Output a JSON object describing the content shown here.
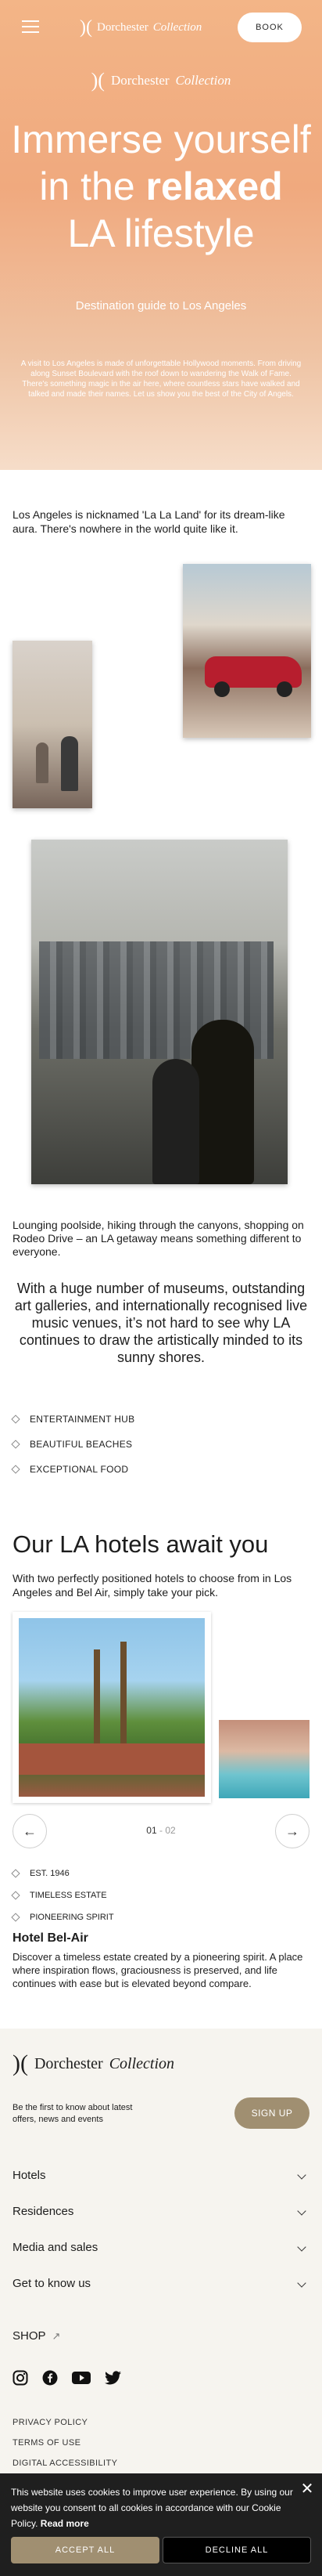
{
  "header": {
    "brand_plain": "Dorchester",
    "brand_italic": "Collection",
    "book_label": "BOOK"
  },
  "hero": {
    "title_line1": "Immerse yourself",
    "title_in_the": "in the ",
    "title_bold": "relaxed",
    "title_line3": "LA lifestyle",
    "subtitle": "Destination guide to Los Angeles",
    "description": "A visit to Los Angeles is made of unforgettable Hollywood moments. From driving along Sunset Boulevard with the roof down to wandering the Walk of Fame. There's something magic in the air here, where countless stars have walked and talked and made their names. Let us show you the best of the City of Angels."
  },
  "intro": "Los Angeles is nicknamed 'La La Land' for its dream-like aura. There's nowhere in the world quite like it.",
  "text2": "Lounging poolside, hiking through the canyons, shopping on Rodeo Drive – an LA getaway means something different to everyone.",
  "quote": "With a huge number of museums, outstanding art galleries, and internationally recognised live music venues, it’s not hard to see why LA continues to draw the artistically minded to its sunny shores.",
  "features": [
    "ENTERTAINMENT HUB",
    "BEAUTIFUL BEACHES",
    "EXCEPTIONAL FOOD"
  ],
  "hotels": {
    "title": "Our LA hotels await you",
    "subtitle": "With two perfectly positioned hotels to choose from in Los Angeles and Bel Air, simply take your pick.",
    "counter_current": "01",
    "counter_sep": " - ",
    "counter_total": "02",
    "features": [
      "EST. 1946",
      "TIMELESS ESTATE",
      "PIONEERING SPIRIT"
    ],
    "name": "Hotel Bel-Air",
    "description": "Discover a timeless estate created by a pioneering spirit. A place where inspiration flows, graciousness is preserved, and life continues with ease but is elevated beyond compare."
  },
  "footer": {
    "brand_plain": "Dorchester",
    "brand_italic": "Collection",
    "newsletter": "Be the first to know about latest offers, news and events",
    "signup_label": "SIGN UP",
    "links": [
      "Hotels",
      "Residences",
      "Media and sales",
      "Get to know us"
    ],
    "shop_label": "SHOP",
    "social": [
      "instagram-icon",
      "facebook-icon",
      "youtube-icon",
      "twitter-icon"
    ],
    "legal": [
      "PRIVACY POLICY",
      "TERMS OF USE",
      "DIGITAL ACCESSIBILITY"
    ]
  },
  "cookie": {
    "text": "This website uses cookies to improve user experience. By using our website you consent to all cookies in accordance with our Cookie Policy. ",
    "read_more": "Read more",
    "accept_label": "ACCEPT ALL",
    "decline_label": "DECLINE ALL"
  }
}
